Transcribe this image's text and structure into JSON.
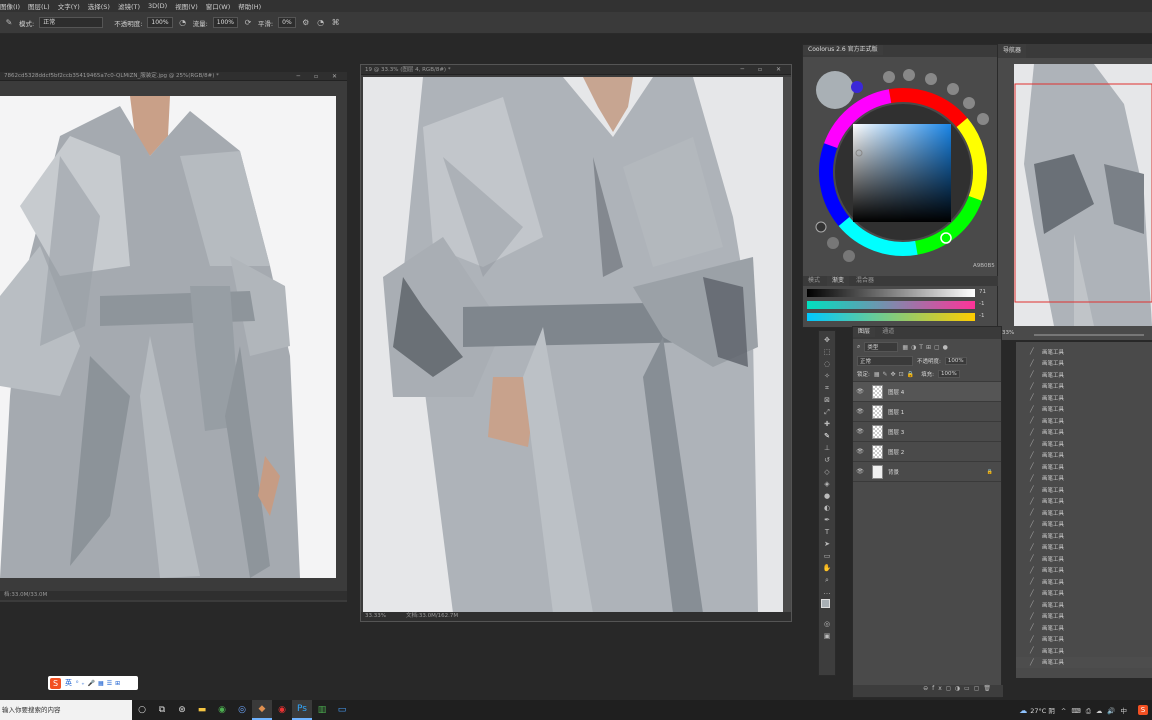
{
  "menu": [
    "图像(I)",
    "图层(L)",
    "文字(Y)",
    "选择(S)",
    "滤镜(T)",
    "3D(D)",
    "视图(V)",
    "窗口(W)",
    "帮助(H)"
  ],
  "options": {
    "mode_label": "模式:",
    "mode_value": "正常",
    "opacity_label": "不透明度:",
    "opacity_value": "100%",
    "flow_label": "流量:",
    "flow_value": "100%",
    "smooth_label": "平滑:",
    "smooth_value": "0%"
  },
  "doc_left": {
    "title": "7862cd5328ddcf5bf2ccb35419465a7c0-QLMiZN_服装定.jpg @ 25%(RGB/8#) *",
    "status": "档:33.0M/33.0M"
  },
  "doc_center": {
    "title": "19 @ 33.3% (图层 4, RGB/8#) *",
    "zoom": "33.33%",
    "status": "文档:33.0M/162.7M"
  },
  "coolorus": {
    "title": "Coolorus 2.6 官方正式版",
    "hex": "A9B0B5",
    "tab_mode": "模式",
    "tab_gradient": "渐变",
    "tab_mix": "混合器",
    "slider_vals": [
      "71",
      "-1",
      "-1"
    ]
  },
  "navigator": {
    "title": "导航器",
    "zoom": "33%"
  },
  "layers": {
    "tabs": [
      "图层",
      "通道"
    ],
    "filter": "类型",
    "blend": "正常",
    "opacity_label": "不透明度:",
    "opacity_value": "100%",
    "lock_label": "锁定:",
    "fill_label": "填充:",
    "fill_value": "100%",
    "rows": [
      {
        "name": "图层 4",
        "selected": true
      },
      {
        "name": "图层 1",
        "selected": false
      },
      {
        "name": "图层 3",
        "selected": false
      },
      {
        "name": "图层 2",
        "selected": false
      },
      {
        "name": "背景",
        "selected": false
      }
    ]
  },
  "history": {
    "item": "画笔工具",
    "count": 28
  },
  "taskbar": {
    "search": "输入你要搜索的内容",
    "temp": "27°C 阴",
    "ime": "英"
  }
}
